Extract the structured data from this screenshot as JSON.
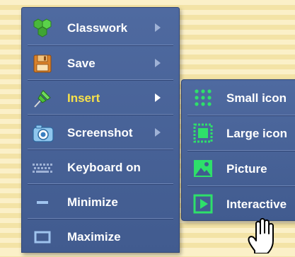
{
  "menu": {
    "items": [
      {
        "label": "Classwork",
        "icon": "classwork-hexagons-icon",
        "has_submenu": true
      },
      {
        "label": "Save",
        "icon": "floppy-disk-icon",
        "has_submenu": true
      },
      {
        "label": "Insert",
        "icon": "pushpin-icon",
        "has_submenu": true,
        "active": true
      },
      {
        "label": "Screenshot",
        "icon": "camera-icon",
        "has_submenu": true
      },
      {
        "label": "Keyboard on",
        "icon": "keyboard-icon",
        "has_submenu": false
      },
      {
        "label": "Minimize",
        "icon": "minimize-icon",
        "has_submenu": false
      },
      {
        "label": "Maximize",
        "icon": "maximize-icon",
        "has_submenu": false
      }
    ]
  },
  "submenu": {
    "items": [
      {
        "label": "Small icon",
        "icon": "small-icon-grid-icon"
      },
      {
        "label": "Large icon",
        "icon": "large-icon-square-icon"
      },
      {
        "label": "Picture",
        "icon": "picture-icon"
      },
      {
        "label": "Interactive",
        "icon": "play-icon"
      }
    ]
  },
  "colors": {
    "menu_bg": "#4a639a",
    "active_label": "#f7e14a",
    "submenu_icon": "#2ee06a",
    "background_stripe": "#fbf0c8"
  }
}
